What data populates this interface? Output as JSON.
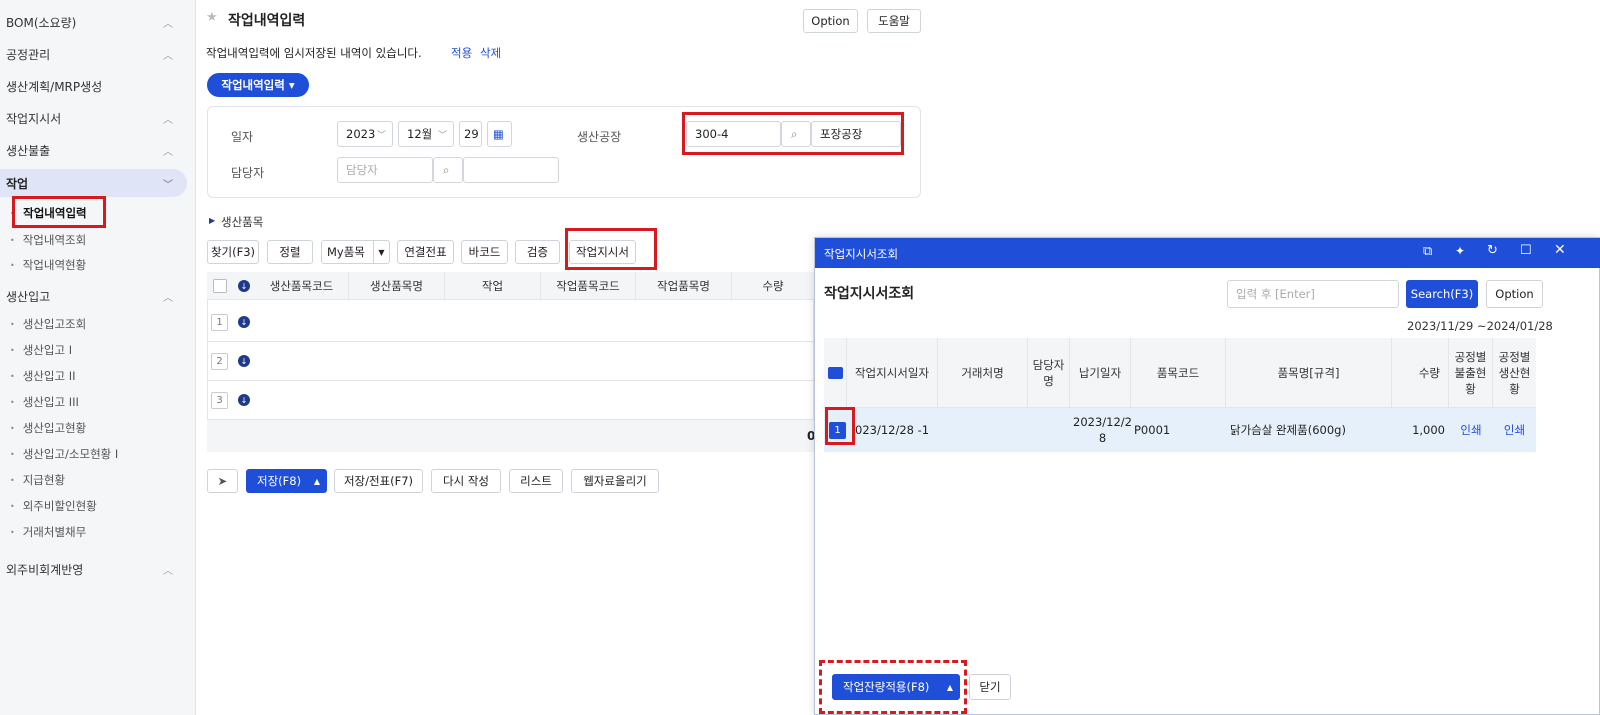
{
  "sidebar": {
    "groups": [
      {
        "label": "BOM(소요량)",
        "chevron": "^"
      },
      {
        "label": "공정관리",
        "chevron": "^"
      },
      {
        "label": "생산계획/MRP생성",
        "chevron": ""
      },
      {
        "label": "작업지시서",
        "chevron": "^"
      },
      {
        "label": "생산불출",
        "chevron": "^"
      },
      {
        "label": "작업",
        "chevron": "v"
      }
    ],
    "work_items": [
      "작업내역입력",
      "작업내역조회",
      "작업내역현황"
    ],
    "production_group": {
      "label": "생산입고",
      "chevron": "^"
    },
    "production_items": [
      "생산입고조회",
      "생산입고 I",
      "생산입고 II",
      "생산입고 III",
      "생산입고현황",
      "생산입고/소모현황 I",
      "지급현황",
      "외주비할인현황",
      "거래처별채무"
    ],
    "last_group": {
      "label": "외주비회계반영",
      "chevron": "^"
    }
  },
  "header": {
    "title": "작업내역입력",
    "option": "Option",
    "help": "도움말",
    "notice": "작업내역입력에 임시저장된 내역이 있습니다.",
    "apply": "적용",
    "delete": "삭제",
    "dropdown": "작업내역입력 ▾"
  },
  "form": {
    "date_label": "일자",
    "year": "2023",
    "month": "12월",
    "day": "29",
    "person_label": "담당자",
    "person_placeholder": "담당자",
    "factory_label": "생산공장",
    "factory_code": "300-4",
    "factory_name": "포장공장"
  },
  "section": {
    "label": "생산품목"
  },
  "toolbar": {
    "find": "찾기(F3)",
    "sort": "정렬",
    "my_item": "My품목",
    "linked": "연결전표",
    "barcode": "바코드",
    "verify": "검증",
    "work_order": "작업지시서"
  },
  "grid": {
    "columns": [
      "생산품목코드",
      "생산품목명",
      "작업",
      "작업품목코드",
      "작업품목명",
      "수량"
    ],
    "rows": [
      "1",
      "2",
      "3"
    ],
    "total_fragment": "0"
  },
  "footer": {
    "save": "저장(F8)",
    "save_slip": "저장/전표(F7)",
    "rewrite": "다시 작성",
    "list": "리스트",
    "upload": "웹자료올리기"
  },
  "modal": {
    "bar_title": "작업지시서조회",
    "title": "작업지시서조회",
    "search_placeholder": "입력 후 [Enter]",
    "search": "Search(F3)",
    "option": "Option",
    "date_range": "2023/11/29 ~2024/01/28",
    "columns": [
      "작업지시서일자",
      "거래처명",
      "담당자명",
      "납기일자",
      "품목코드",
      "품목명[규격]",
      "수량",
      "공정별불출현황",
      "공정별생산현황"
    ],
    "row": {
      "num": "1",
      "date": "023/12/28 -1",
      "client": "",
      "person": "",
      "due": "2023/12/28",
      "code": "P0001",
      "name": "닭가슴살 완제품(600g)",
      "qty": "1,000",
      "issue": "인쇄",
      "prod": "인쇄"
    },
    "apply": "작업잔량적용(F8)",
    "close": "닫기"
  },
  "colors": {
    "accent": "#1f4fd8",
    "highlight": "#d71920"
  }
}
